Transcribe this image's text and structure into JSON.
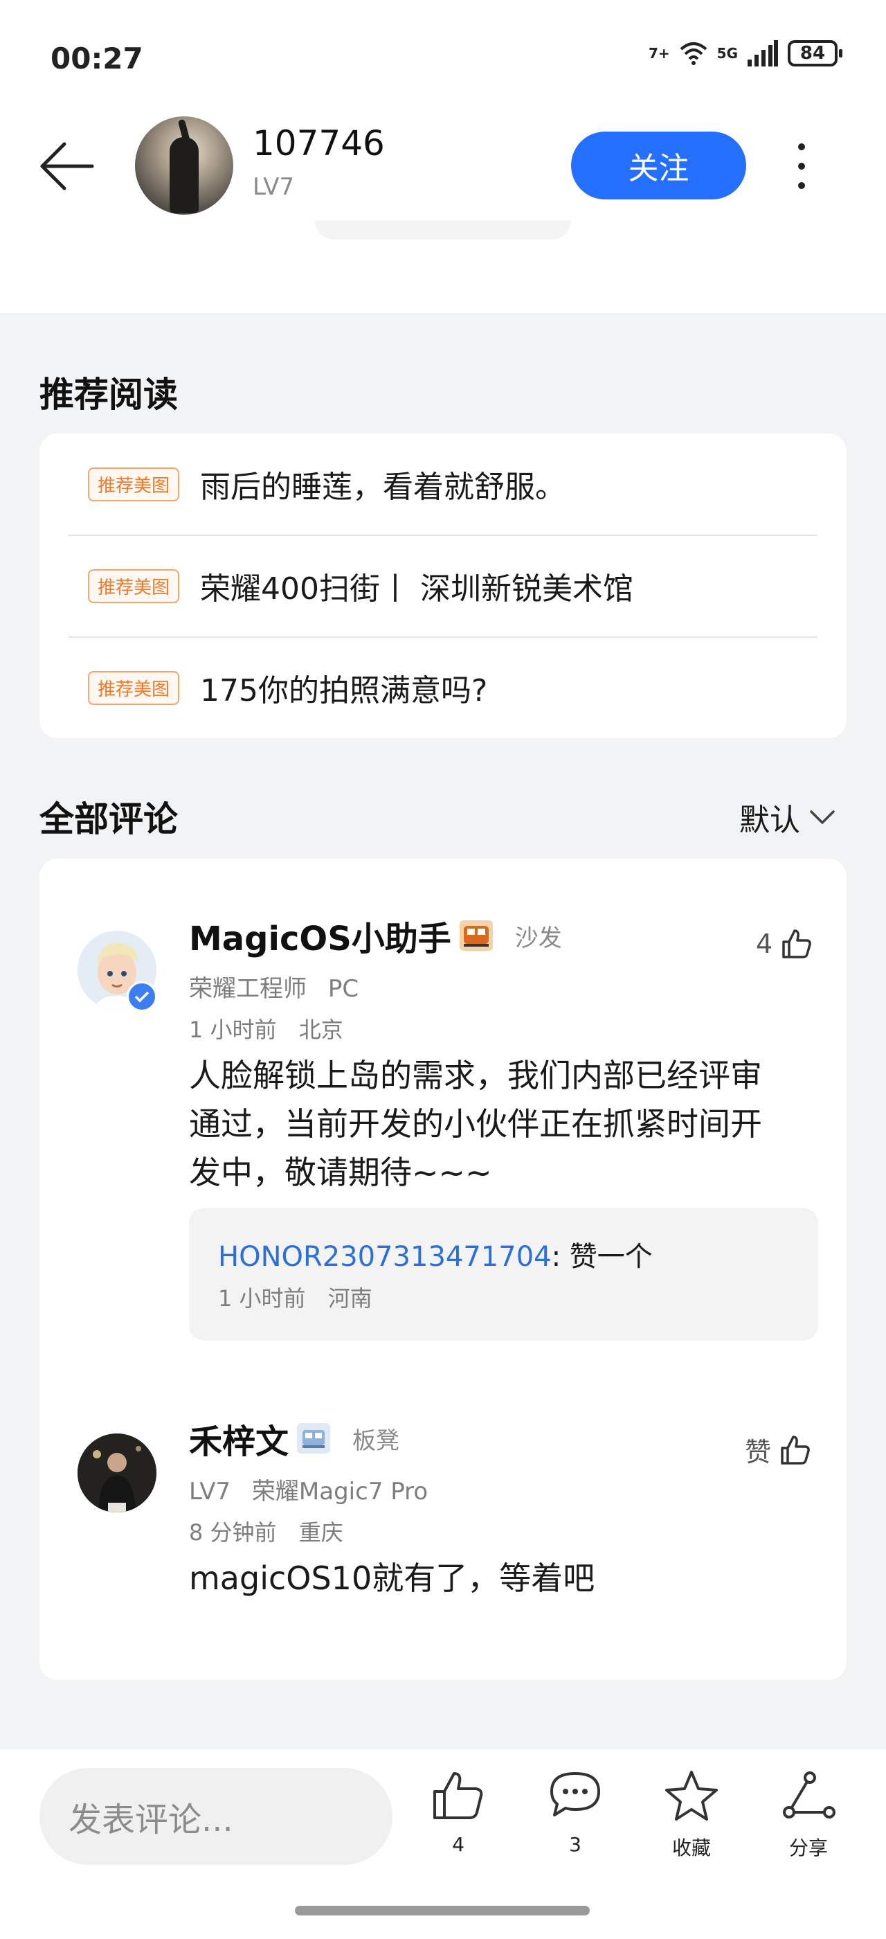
{
  "status_bar": {
    "time": "00:27",
    "wifi_label": "7+",
    "cellular_label": "5G",
    "battery": "84"
  },
  "header": {
    "username": "107746",
    "level": "LV7",
    "follow_label": "关注"
  },
  "recommend": {
    "title": "推荐阅读",
    "items": [
      {
        "tag": "推荐美图",
        "text": "雨后的睡莲，看着就舒服。"
      },
      {
        "tag": "推荐美图",
        "text": "荣耀400扫街丨 深圳新锐美术馆"
      },
      {
        "tag": "推荐美图",
        "text": "175你的拍照满意吗?"
      }
    ]
  },
  "comments_section": {
    "title": "全部评论",
    "sort_label": "默认"
  },
  "comments": [
    {
      "name": "MagicOS小助手",
      "rank": "沙发",
      "role": "荣耀工程师",
      "device": "PC",
      "time": "1 小时前",
      "location": "北京",
      "text_lines": [
        "人脸解锁上岛的需求，我们内部已经评审",
        "通过，当前开发的小伙伴正在抓紧时间开",
        "发中，敬请期待~~~"
      ],
      "likes": "4",
      "reply": {
        "user": "HONOR2307313471704",
        "text": ": 赞一个",
        "time": "1 小时前",
        "location": "河南"
      }
    },
    {
      "name": "禾梓文",
      "rank": "板凳",
      "role": "LV7",
      "device": "荣耀Magic7 Pro",
      "time": "8 分钟前",
      "location": "重庆",
      "text": "magicOS10就有了，等着吧",
      "likes": "赞"
    }
  ],
  "bottom_bar": {
    "input_placeholder": "发表评论...",
    "like_count": "4",
    "comment_count": "3",
    "favorite_label": "收藏",
    "share_label": "分享"
  },
  "colors": {
    "accent": "#256fff",
    "tag_orange": "#ec7a2a",
    "reply_link": "#2d6fd8"
  }
}
